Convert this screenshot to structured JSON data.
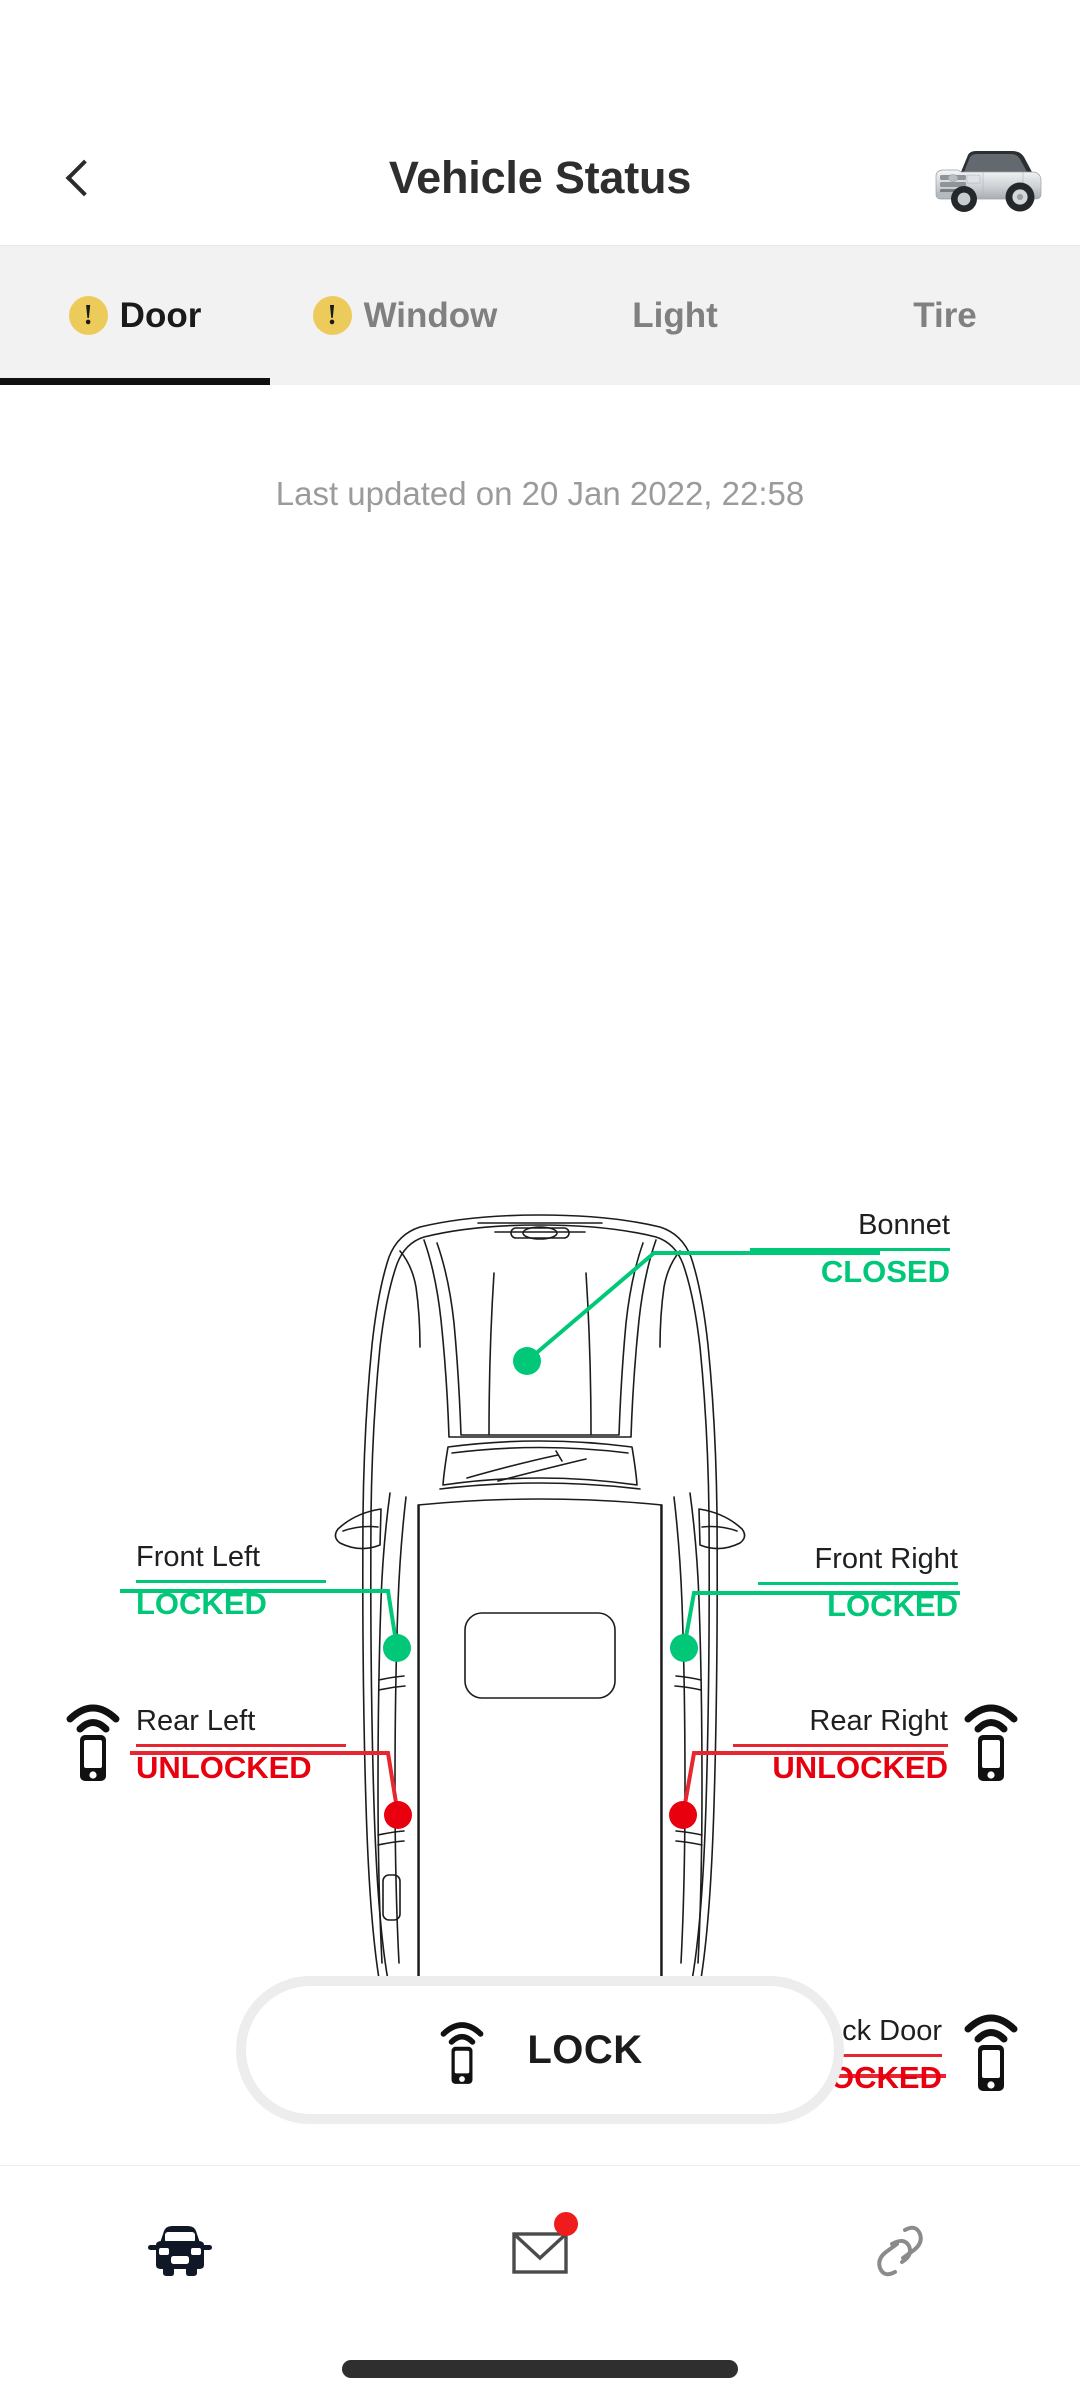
{
  "header": {
    "title": "Vehicle Status",
    "back_icon": "chevron-left-icon",
    "vehicle_thumb_icon": "suv-photo-icon"
  },
  "tabs": [
    {
      "label": "Door",
      "active": true,
      "warning": true,
      "warning_icon": "exclamation-circle-icon"
    },
    {
      "label": "Window",
      "active": false,
      "warning": true,
      "warning_icon": "exclamation-circle-icon"
    },
    {
      "label": "Light",
      "active": false,
      "warning": false,
      "warning_icon": ""
    },
    {
      "label": "Tire",
      "active": false,
      "warning": false,
      "warning_icon": ""
    }
  ],
  "status": {
    "last_updated": "Last updated on 20 Jan 2022, 22:58"
  },
  "colors": {
    "green": "#00c878",
    "red": "#e8000f",
    "warning_yellow": "#edcb5a",
    "tab_bg": "#f2f2f2",
    "badge_red": "#f01b1b"
  },
  "diagram": {
    "vehicle_icon": "car-top-view-icon",
    "points": [
      {
        "id": "bonnet",
        "name": "Bonnet",
        "state": "CLOSED",
        "color": "green",
        "fob": false
      },
      {
        "id": "front_left",
        "name": "Front Left",
        "state": "LOCKED",
        "color": "green",
        "fob": false
      },
      {
        "id": "front_right",
        "name": "Front Right",
        "state": "LOCKED",
        "color": "green",
        "fob": false
      },
      {
        "id": "rear_left",
        "name": "Rear Left",
        "state": "UNLOCKED",
        "color": "red",
        "fob": true
      },
      {
        "id": "rear_right",
        "name": "Rear Right",
        "state": "UNLOCKED",
        "color": "red",
        "fob": true
      },
      {
        "id": "back_door",
        "name": "Back Door",
        "state": "UNLOCKED",
        "color": "red",
        "fob": true
      }
    ]
  },
  "action": {
    "lock_label": "LOCK",
    "lock_icon": "key-fob-icon"
  },
  "bottom_nav": [
    {
      "id": "vehicle",
      "icon": "car-front-icon",
      "active": true,
      "badge": false
    },
    {
      "id": "messages",
      "icon": "envelope-icon",
      "active": false,
      "badge": true
    },
    {
      "id": "link",
      "icon": "link-chain-icon",
      "active": false,
      "badge": false
    }
  ]
}
